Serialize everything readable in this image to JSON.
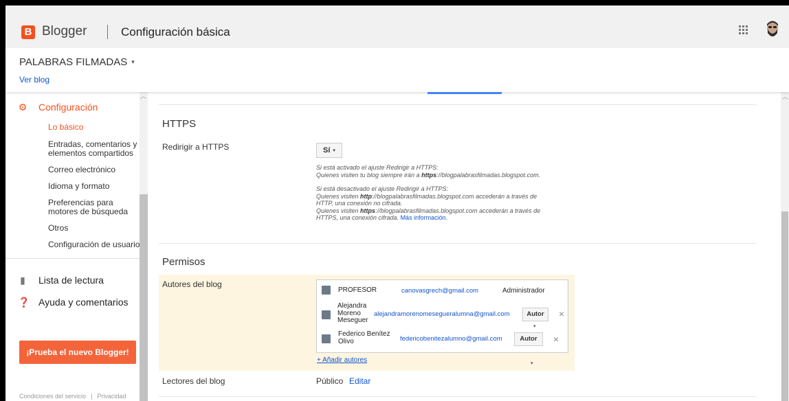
{
  "header": {
    "logo_letter": "B",
    "brand": "Blogger",
    "page_title": "Configuración básica"
  },
  "blog": {
    "name": "PALABRAS FILMADAS",
    "view_link": "Ver blog"
  },
  "sidebar": {
    "settings_label": "Configuración",
    "subitems": [
      "Lo básico",
      "Entradas, comentarios y elementos compartidos",
      "Correo electrónico",
      "Idioma y formato",
      "Preferencias para motores de búsqueda",
      "Otros",
      "Configuración de usuario"
    ],
    "reading_list": "Lista de lectura",
    "help": "Ayuda y comentarios",
    "try_button": "¡Prueba el nuevo Blogger!",
    "terms": "Condiciones del servicio",
    "privacy": "Privacidad"
  },
  "https": {
    "title": "HTTPS",
    "redirect_label": "Redirigir a HTTPS",
    "select_value": "Sí",
    "note_on_1": "Si está activado el ajuste Redirigir a HTTPS:",
    "note_on_2a": "Quienes visiten tu blog siempre irán a ",
    "note_on_2b": "https",
    "note_on_2c": "://blogpalabrasfilmadas.blogspot.com.",
    "note_off_1": "Si está desactivado el ajuste Redirigir a HTTPS:",
    "note_off_2a": "Quienes visiten ",
    "note_off_2b": "http",
    "note_off_2c": "://blogpalabrasfilmadas.blogspot.com accederán a través de",
    "note_off_3": "HTTP, una conexión no cifrada.",
    "note_off_4a": "Quienes visiten ",
    "note_off_4b": "https",
    "note_off_4c": "://blogpalabrasfilmadas.blogspot.com accederán a través de",
    "note_off_5": "HTTPS, una conexión cifrada. ",
    "more_info": "Más información."
  },
  "permissions": {
    "title": "Permisos",
    "authors_label": "Autores del blog",
    "authors": [
      {
        "name": "PROFESOR",
        "email": "canovasgrech@gmail.com",
        "role": "Administrador"
      },
      {
        "name_lines": [
          "Alejandra",
          "Moreno",
          "Meseguer"
        ],
        "email": "alejandramorenomesegueralumna@gmail.com",
        "role": "Autor"
      },
      {
        "name_lines": [
          "Federico Benítez",
          "Olivo"
        ],
        "email": "federicobenitezalumno@gmail.com",
        "role": "Autor"
      }
    ],
    "add_authors": "+ Añadir autores",
    "readers_label": "Lectores del blog",
    "readers_value": "Público",
    "readers_edit": "Editar"
  },
  "icons": {
    "remove": "×",
    "caret": "▾"
  },
  "colors": {
    "accent": "#f4511e",
    "link": "#1155cc",
    "highlight_band": "#fdf5e0"
  }
}
